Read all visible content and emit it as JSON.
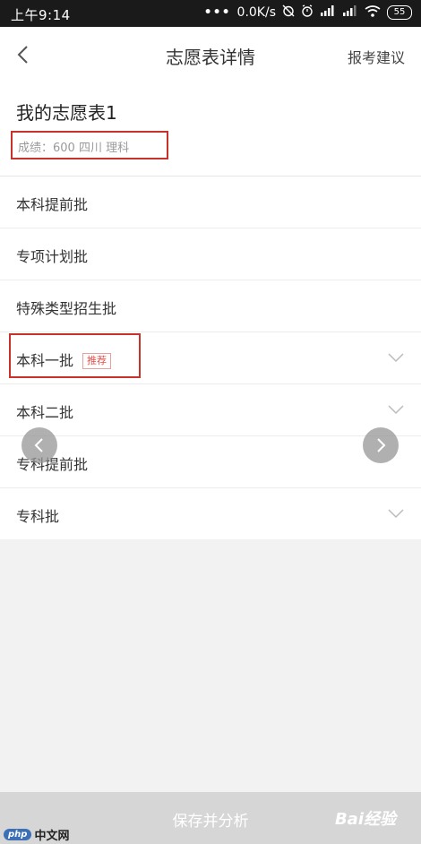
{
  "status_bar": {
    "time": "上午9:14",
    "dots": "•••",
    "speed": "0.0K/s",
    "battery": "55"
  },
  "header": {
    "back_icon": "chevron-left-icon",
    "title": "志愿表详情",
    "advice_label": "报考建议"
  },
  "plan": {
    "name": "我的志愿表1",
    "score_line": "成绩：600   四川   理科"
  },
  "batches": [
    {
      "label": "本科提前批",
      "tag": "",
      "expandable": false
    },
    {
      "label": "专项计划批",
      "tag": "",
      "expandable": false
    },
    {
      "label": "特殊类型招生批",
      "tag": "",
      "expandable": false
    },
    {
      "label": "本科一批",
      "tag": "推荐",
      "expandable": true
    },
    {
      "label": "本科二批",
      "tag": "",
      "expandable": true
    },
    {
      "label": "专科提前批",
      "tag": "",
      "expandable": false
    },
    {
      "label": "专科批",
      "tag": "",
      "expandable": true
    }
  ],
  "bottom": {
    "save_label": "保存并分析",
    "watermark_baidu": "Bai经验",
    "watermark_php_logo": "php",
    "watermark_php_text": "中文网"
  },
  "colors": {
    "highlight_box": "#c9312b",
    "tag": "#e0504b",
    "bottom_bar": "#d6d6d6"
  }
}
